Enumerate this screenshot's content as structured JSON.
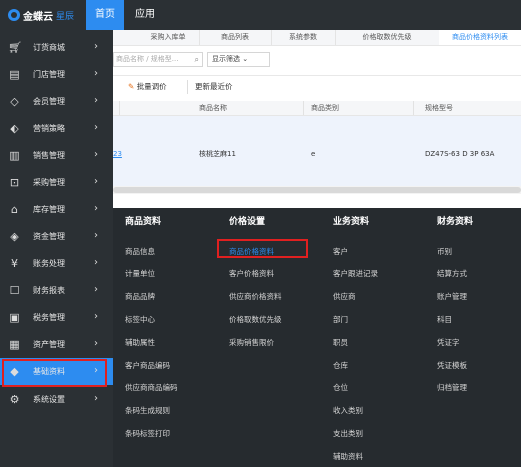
{
  "header": {
    "brand": "金蝶云",
    "brand_sub": "星辰",
    "tabs": [
      {
        "label": "首页",
        "active": true
      },
      {
        "label": "应用",
        "active": false
      }
    ]
  },
  "sidebar": {
    "items": [
      {
        "label": "订货商城",
        "icon": "cart-icon"
      },
      {
        "label": "门店管理",
        "icon": "store-icon"
      },
      {
        "label": "会员管理",
        "icon": "diamond-icon"
      },
      {
        "label": "营销策略",
        "icon": "tag-icon"
      },
      {
        "label": "销售管理",
        "icon": "bar-chart-icon"
      },
      {
        "label": "采购管理",
        "icon": "bag-icon"
      },
      {
        "label": "库存管理",
        "icon": "warehouse-icon"
      },
      {
        "label": "资金管理",
        "icon": "money-icon"
      },
      {
        "label": "账务处理",
        "icon": "yen-icon"
      },
      {
        "label": "财务报表",
        "icon": "report-icon"
      },
      {
        "label": "税务管理",
        "icon": "tax-icon"
      },
      {
        "label": "资产管理",
        "icon": "asset-icon"
      },
      {
        "label": "基础资料",
        "icon": "layers-icon",
        "active": true
      },
      {
        "label": "系统设置",
        "icon": "gear-icon"
      }
    ]
  },
  "page_tabs": [
    {
      "label": "采购入库单"
    },
    {
      "label": "商品列表"
    },
    {
      "label": "系统参数"
    },
    {
      "label": "价格取数优先级"
    },
    {
      "label": "商品价格资料列表",
      "active": true
    }
  ],
  "search": {
    "placeholder": "商品名称 / 规格型..."
  },
  "filter": {
    "label": "显示筛选"
  },
  "toolbar": {
    "batch_adjust": "批量调价",
    "update_recent": "更新最近价"
  },
  "table": {
    "headers": [
      "商品名称",
      "商品类别",
      "规格型号"
    ],
    "rows": [
      {
        "code": "23",
        "name": "核桃芝麻11",
        "category": "e",
        "spec": "DZ47S-63 D 3P 63A"
      }
    ]
  },
  "mega_menu": {
    "columns": [
      {
        "title": "商品资料",
        "items": [
          "商品信息",
          "计量单位",
          "商品品牌",
          "标签中心",
          "辅助属性",
          "客户商品编码",
          "供应商商品编码",
          "条码生成规则",
          "条码标签打印"
        ]
      },
      {
        "title": "价格设置",
        "items": [
          "商品价格资料",
          "客户价格资料",
          "供应商价格资料",
          "价格取数优先级",
          "采购销售限价"
        ],
        "highlighted": "商品价格资料"
      },
      {
        "title": "业务资料",
        "items": [
          "客户",
          "客户跟进记录",
          "供应商",
          "部门",
          "职员",
          "仓库",
          "仓位",
          "收入类别",
          "支出类别",
          "辅助资料"
        ]
      },
      {
        "title": "财务资料",
        "items": [
          "币别",
          "结算方式",
          "账户管理",
          "科目",
          "凭证字",
          "凭证模板",
          "归档管理"
        ]
      }
    ]
  },
  "colors": {
    "dark_bg": "#2b3034",
    "mega_bg": "#262b2f",
    "accent": "#2d8cf0",
    "highlight_box": "#e02020",
    "row_selected": "#eef3fc"
  }
}
